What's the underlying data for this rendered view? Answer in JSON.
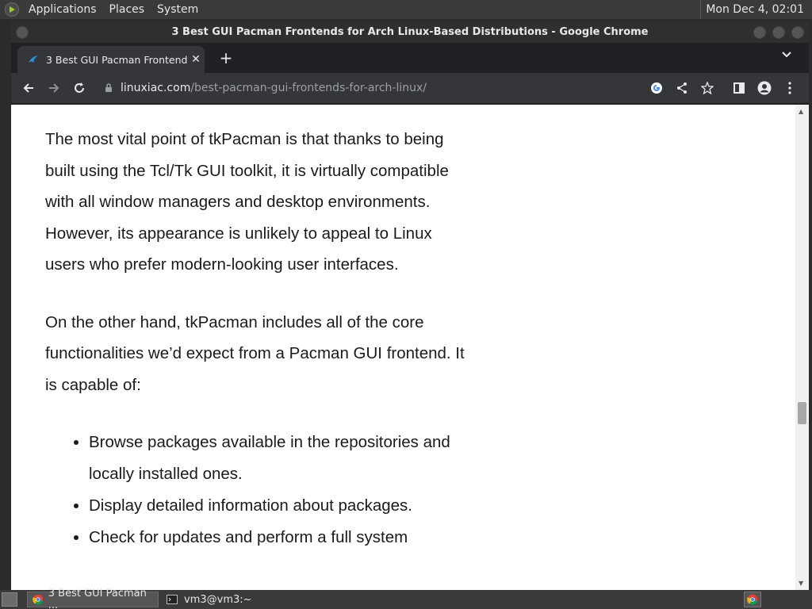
{
  "system_panel": {
    "menus": [
      "Applications",
      "Places",
      "System"
    ],
    "clock": "Mon Dec  4, 02:01"
  },
  "window": {
    "title": "3 Best GUI Pacman Frontends for Arch Linux-Based Distributions - Google Chrome"
  },
  "tab": {
    "title": "3 Best GUI Pacman Frontends",
    "close": "✕",
    "new_tab": "+"
  },
  "omnibox": {
    "host": "linuxiac.com",
    "path": "/best-pacman-gui-frontends-for-arch-linux/"
  },
  "article": {
    "paragraphs": [
      "The most vital point of tkPacman is that thanks to being built using the Tcl/Tk GUI toolkit, it is virtually compatible with all window managers and desktop environments. However, its appearance is unlikely to appeal to Linux users who prefer modern-looking user interfaces.",
      "On the other hand, tkPacman includes all of the core functionalities we’d expect from a Pacman GUI frontend. It is capable of:"
    ],
    "bullets": [
      "Browse packages available in the repositories and locally installed ones.",
      "Display detailed information about packages.",
      "Check for updates and perform a full system"
    ]
  },
  "taskbar": {
    "chrome_task": "3 Best GUI Pacman ...",
    "terminal_task": "vm3@vm3:~"
  },
  "colors": {
    "chrome_dark": "#35363a",
    "tab_strip": "#202124",
    "panel": "#3a3a3a"
  }
}
